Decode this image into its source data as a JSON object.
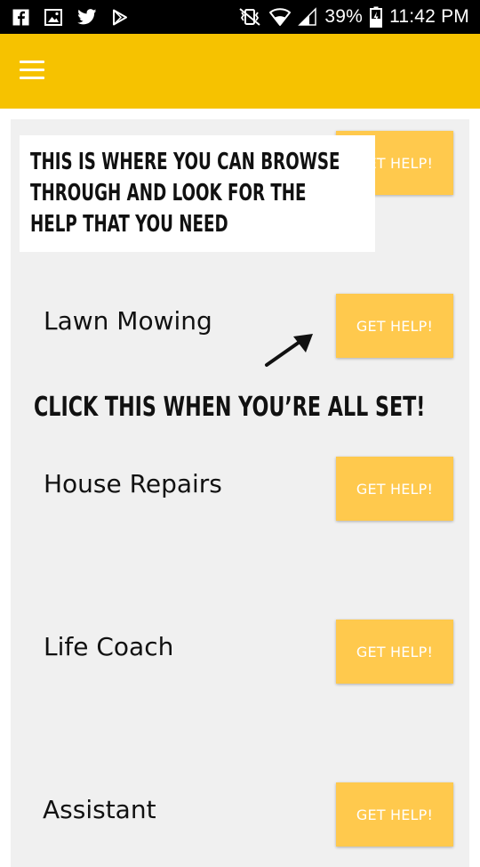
{
  "status_bar": {
    "left_icons": [
      "facebook-icon",
      "gallery-icon",
      "twitter-icon",
      "play-store-icon"
    ],
    "battery_percent": "39%",
    "time": "11:42 PM"
  },
  "app_bar": {
    "color": "#f6c200",
    "menu_icon": "hamburger-menu-icon"
  },
  "services": [
    {
      "name": "",
      "button": "GET HELP!"
    },
    {
      "name": "Lawn Mowing",
      "button": "GET HELP!"
    },
    {
      "name": "House Repairs",
      "button": "GET HELP!"
    },
    {
      "name": "Life Coach",
      "button": "GET HELP!"
    },
    {
      "name": "Assistant",
      "button": "GET HELP!"
    }
  ],
  "tutorial": {
    "tip_lines": [
      "THIS IS WHERE YOU CAN BROWSE",
      "THROUGH AND LOOK FOR THE",
      "HELP THAT YOU NEED"
    ],
    "arrow_note": "CLICK THIS WHEN YOU’RE ALL SET!"
  },
  "colors": {
    "button": "#ffc94d",
    "list_background": "#f0f0f0"
  }
}
